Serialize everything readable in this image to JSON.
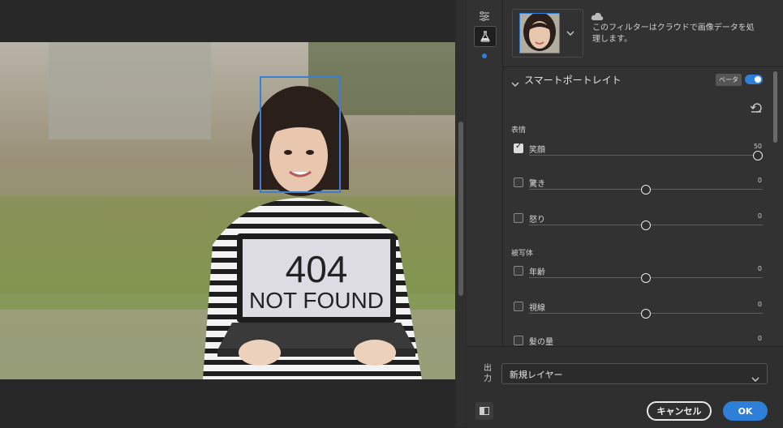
{
  "cloud_note": "このフィルターはクラウドで画像データを処理します。",
  "section": {
    "title": "スマートポートレイト",
    "badge": "ベータ"
  },
  "groups": {
    "expression": "表情",
    "subject": "被写体"
  },
  "sliders": [
    {
      "label": "笑顔",
      "value": "50",
      "checked": true,
      "pos": 1.0
    },
    {
      "label": "驚き",
      "value": "0",
      "checked": false,
      "pos": 0.5
    },
    {
      "label": "怒り",
      "value": "0",
      "checked": false,
      "pos": 0.5
    },
    {
      "label": "年齢",
      "value": "0",
      "checked": false,
      "pos": 0.5
    },
    {
      "label": "視線",
      "value": "0",
      "checked": false,
      "pos": 0.5
    },
    {
      "label": "髪の量",
      "value": "0",
      "checked": false,
      "pos": 0.5
    }
  ],
  "output": {
    "label": "出力",
    "value": "新規レイヤー"
  },
  "buttons": {
    "cancel": "キャンセル",
    "ok": "OK"
  },
  "photo_laptop": {
    "line1": "404",
    "line2": "NOT FOUND"
  },
  "colors": {
    "accent": "#2d7fd8",
    "panel": "#323232"
  }
}
